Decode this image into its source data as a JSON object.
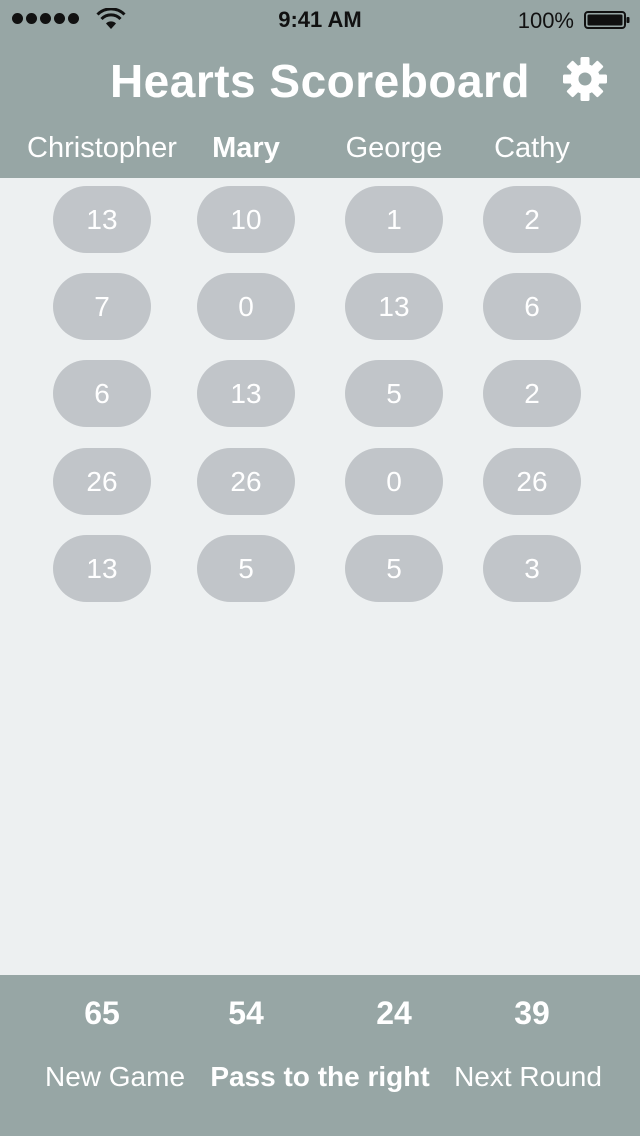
{
  "status_bar": {
    "time": "9:41 AM",
    "battery": "100%"
  },
  "header": {
    "title": "Hearts Scoreboard",
    "settings_icon": "gear-icon"
  },
  "players": [
    "Christopher",
    "Mary",
    "George",
    "Cathy"
  ],
  "active_player": "Mary",
  "rounds": [
    [
      "13",
      "10",
      "1",
      "2"
    ],
    [
      "7",
      "0",
      "13",
      "6"
    ],
    [
      "6",
      "13",
      "5",
      "2"
    ],
    [
      "26",
      "26",
      "0",
      "26"
    ],
    [
      "13",
      "5",
      "5",
      "3"
    ]
  ],
  "totals": [
    "65",
    "54",
    "24",
    "39"
  ],
  "footer": {
    "new_game": "New Game",
    "pass_direction": "Pass to the right",
    "next_round": "Next Round"
  },
  "colors": {
    "header": "#97a6a5",
    "background": "#edf0f1",
    "score_pill": "#c1c5c9"
  }
}
